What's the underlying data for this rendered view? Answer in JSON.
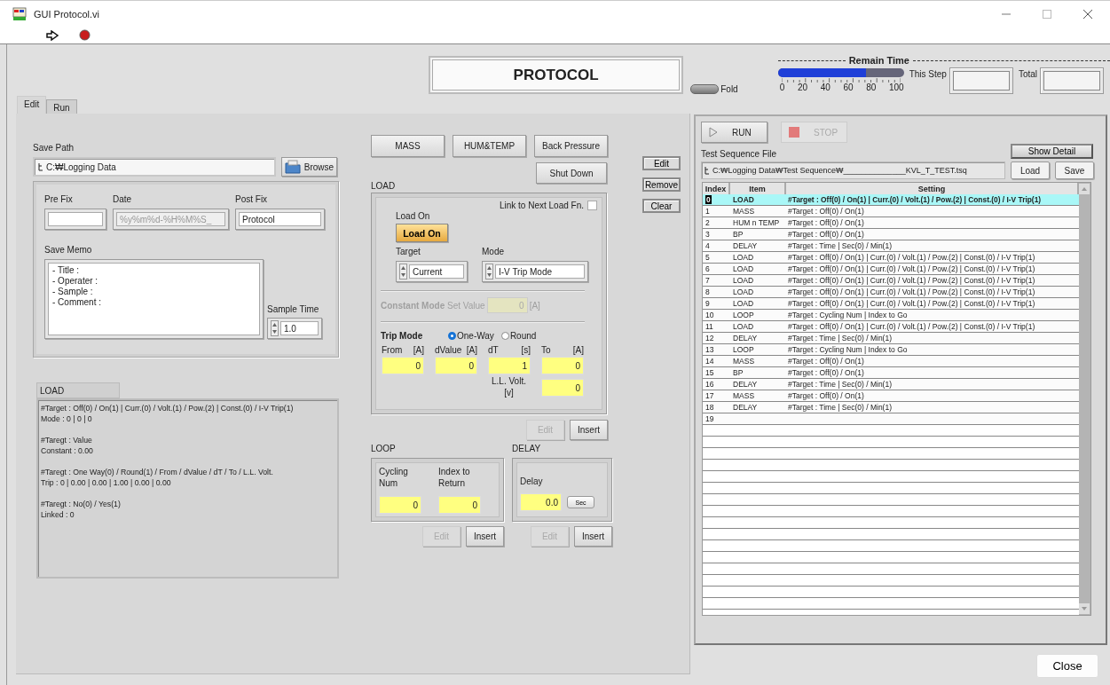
{
  "window": {
    "title": "GUI Protocol.vi"
  },
  "header": {
    "title": "PROTOCOL"
  },
  "fold": {
    "label": "Fold",
    "on": false
  },
  "remain_time": {
    "label": "Remain Time",
    "level": 0.7,
    "ticks": [
      "0",
      "20",
      "40",
      "60",
      "80",
      "100"
    ],
    "this_step": {
      "label": "This Step"
    },
    "total": {
      "label": "Total"
    }
  },
  "tabs": [
    {
      "label": "Edit",
      "selected": true
    },
    {
      "label": "Run",
      "selected": false
    }
  ],
  "save": {
    "path_label": "Save Path",
    "path": "C:₩Logging Data",
    "browse": "Browse",
    "prefix_label": "Pre Fix",
    "date_label": "Date",
    "date": "%y%m%d-%H%M%S_",
    "postfix_label": "Post Fix",
    "postfix": "Protocol",
    "memo_label": "Save Memo",
    "memo": [
      "- Title :",
      "- Operater :",
      "- Sample :",
      "- Comment :"
    ],
    "sample_time_label": "Sample Time",
    "sample_time": "1.0"
  },
  "summary": {
    "item": "LOAD",
    "paragraphs": [
      [
        "#Target : Off(0) / On(1) | Curr.(0) / Volt.(1) / Pow.(2) | Const.(0) / I-V Trip(1)",
        "Mode : 0 | 0 | 0"
      ],
      [
        "#Taregt : Value",
        "Constant : 0.00"
      ],
      [
        "#Taregt : One Way(0) / Round(1) / From / dValue / dT / To / L.L. Volt.",
        "Trip : 0 | 0.00 | 0.00 | 1.00 | 0.00 | 0.00"
      ],
      [
        "#Taregt : No(0) / Yes(1)",
        "Linked : 0"
      ]
    ]
  },
  "function_buttons": [
    "MASS",
    "HUM&TEMP",
    "Back Pressure",
    "Shut Down"
  ],
  "load": {
    "title": "LOAD",
    "link_label": "Link to Next Load Fn.",
    "link_checked": false,
    "load_on_label": "Load On",
    "load_on_button": "Load On",
    "load_on": true,
    "target_label": "Target",
    "target": "Current",
    "mode_label": "Mode",
    "mode": "I-V Trip Mode",
    "constant": {
      "label": "Constant Mode",
      "sub": "Set Value",
      "value": "0",
      "unit": "[A]",
      "disabled": true
    },
    "trip_label": "Trip Mode",
    "trip_options": [
      {
        "label": "One-Way",
        "selected": true
      },
      {
        "label": "Round",
        "selected": false
      }
    ],
    "trip_fields": [
      {
        "label": "From",
        "unit": "[A]",
        "value": "0"
      },
      {
        "label": "dValue",
        "unit": "[A]",
        "value": "0"
      },
      {
        "label": "dT",
        "unit": "[s]",
        "value": "1"
      },
      {
        "label": "To",
        "unit": "[A]",
        "value": "0"
      }
    ],
    "ll_volt": {
      "label": "L.L. Volt.",
      "unit": "[v]",
      "value": "0"
    },
    "buttons": [
      {
        "label": "Edit",
        "disabled": true
      },
      {
        "label": "Insert",
        "disabled": false
      }
    ]
  },
  "loop": {
    "title": "LOOP",
    "fields": [
      {
        "label": "Cycling Num",
        "value": "0"
      },
      {
        "label": "Index to Return",
        "value": "0"
      }
    ],
    "buttons": [
      {
        "label": "Edit",
        "disabled": true
      },
      {
        "label": "Insert",
        "disabled": false
      }
    ]
  },
  "delay": {
    "title": "DELAY",
    "label": "Delay",
    "value": "0.0",
    "unit": "Sec",
    "buttons": [
      {
        "label": "Edit",
        "disabled": true
      },
      {
        "label": "Insert",
        "disabled": false
      }
    ]
  },
  "list_buttons": [
    "Edit",
    "Remove",
    "Clear"
  ],
  "run_panel": {
    "run": {
      "label": "RUN",
      "disabled": false
    },
    "stop": {
      "label": "STOP",
      "disabled": true
    },
    "file_label": "Test Sequence File",
    "show_detail": "Show Detail",
    "file_path": "C:₩Logging Data₩Test Sequence₩______________KVL_T_TEST.tsq",
    "load": "Load",
    "save": "Save"
  },
  "table": {
    "columns": [
      "Index",
      "Item",
      "Setting"
    ],
    "rows": [
      {
        "index": "0",
        "item": "LOAD",
        "setting": "#Target : Off(0) / On(1) | Curr.(0) / Volt.(1) / Pow.(2) | Const.(0) / I-V Trip(1)",
        "selected": true
      },
      {
        "index": "1",
        "item": "MASS",
        "setting": "#Target : Off(0) / On(1)",
        "selected": false
      },
      {
        "index": "2",
        "item": "HUM n TEMP",
        "setting": "#Target : Off(0) / On(1)",
        "selected": false
      },
      {
        "index": "3",
        "item": "BP",
        "setting": "#Target : Off(0) / On(1)",
        "selected": false
      },
      {
        "index": "4",
        "item": "DELAY",
        "setting": "#Target : Time | Sec(0) / Min(1)",
        "selected": false
      },
      {
        "index": "5",
        "item": "LOAD",
        "setting": "#Target : Off(0) / On(1) | Curr.(0) / Volt.(1) / Pow.(2) | Const.(0) / I-V Trip(1)",
        "selected": false
      },
      {
        "index": "6",
        "item": "LOAD",
        "setting": "#Target : Off(0) / On(1) | Curr.(0) / Volt.(1) / Pow.(2) | Const.(0) / I-V Trip(1)",
        "selected": false
      },
      {
        "index": "7",
        "item": "LOAD",
        "setting": "#Target : Off(0) / On(1) | Curr.(0) / Volt.(1) / Pow.(2) | Const.(0) / I-V Trip(1)",
        "selected": false
      },
      {
        "index": "8",
        "item": "LOAD",
        "setting": "#Target : Off(0) / On(1) | Curr.(0) / Volt.(1) / Pow.(2) | Const.(0) / I-V Trip(1)",
        "selected": false
      },
      {
        "index": "9",
        "item": "LOAD",
        "setting": "#Target : Off(0) / On(1) | Curr.(0) / Volt.(1) / Pow.(2) | Const.(0) / I-V Trip(1)",
        "selected": false
      },
      {
        "index": "10",
        "item": "LOOP",
        "setting": "#Target : Cycling Num | Index to Go",
        "selected": false
      },
      {
        "index": "11",
        "item": "LOAD",
        "setting": "#Target : Off(0) / On(1) | Curr.(0) / Volt.(1) / Pow.(2) | Const.(0) / I-V Trip(1)",
        "selected": false
      },
      {
        "index": "12",
        "item": "DELAY",
        "setting": "#Target : Time | Sec(0) / Min(1)",
        "selected": false
      },
      {
        "index": "13",
        "item": "LOOP",
        "setting": "#Target : Cycling Num | Index to Go",
        "selected": false
      },
      {
        "index": "14",
        "item": "MASS",
        "setting": "#Target : Off(0) / On(1)",
        "selected": false
      },
      {
        "index": "15",
        "item": "BP",
        "setting": "#Target : Off(0) / On(1)",
        "selected": false
      },
      {
        "index": "16",
        "item": "DELAY",
        "setting": "#Target : Time | Sec(0) / Min(1)",
        "selected": false
      },
      {
        "index": "17",
        "item": "MASS",
        "setting": "#Target : Off(0) / On(1)",
        "selected": false
      },
      {
        "index": "18",
        "item": "DELAY",
        "setting": "#Target : Time | Sec(0) / Min(1)",
        "selected": false
      },
      {
        "index": "19",
        "selected": false
      }
    ]
  },
  "close_button": "Close"
}
